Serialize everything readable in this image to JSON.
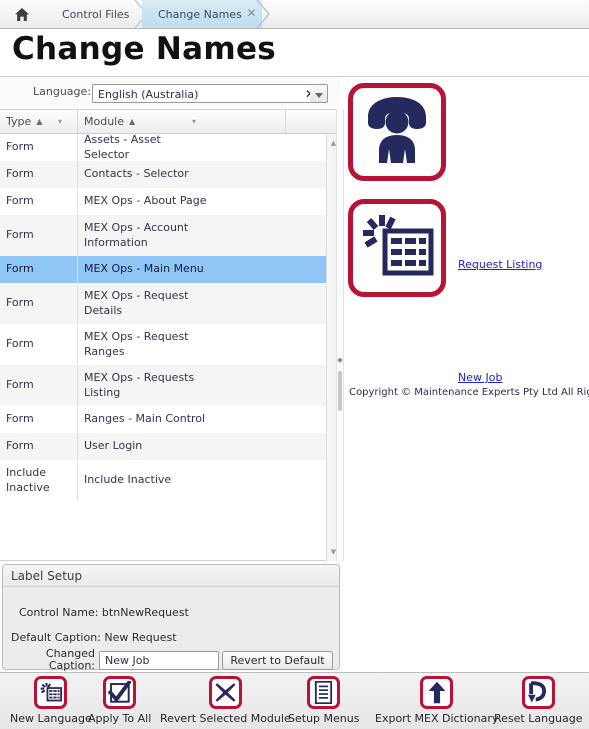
{
  "breadcrumb": {
    "home_icon": "home-icon",
    "items": [
      {
        "label": "Control Files",
        "active": false
      },
      {
        "label": "Change Names",
        "active": true
      }
    ],
    "close_glyph": "✕"
  },
  "page": {
    "title": "Change Names"
  },
  "language": {
    "label": "Language:",
    "value": "English (Australia)",
    "clear_glyph": "✕",
    "dropdown_glyph": "▼"
  },
  "grid": {
    "columns": [
      {
        "label": "Type",
        "sort": "▲",
        "menu": "▾"
      },
      {
        "label": "Module",
        "sort": "▲",
        "menu": "▾"
      },
      {
        "label": "",
        "sort": "",
        "menu": ""
      }
    ],
    "rows": [
      {
        "type": "Form",
        "module": "Assets - Asset Selector",
        "selected": false
      },
      {
        "type": "Form",
        "module": "Contacts - Selector",
        "selected": false
      },
      {
        "type": "Form",
        "module": "MEX Ops - About Page",
        "selected": false
      },
      {
        "type": "Form",
        "module": "MEX Ops - Account Information",
        "selected": false
      },
      {
        "type": "Form",
        "module": "MEX Ops - Main Menu",
        "selected": true
      },
      {
        "type": "Form",
        "module": "MEX Ops - Request Details",
        "selected": false
      },
      {
        "type": "Form",
        "module": "MEX Ops - Request Ranges",
        "selected": false
      },
      {
        "type": "Form",
        "module": "MEX Ops - Requests Listing",
        "selected": false
      },
      {
        "type": "Form",
        "module": "Ranges - Main Control",
        "selected": false
      },
      {
        "type": "Form",
        "module": "User Login",
        "selected": false
      },
      {
        "type": "Include Inactive",
        "module": "Include Inactive",
        "selected": false
      }
    ],
    "scroll_up_glyph": "▲",
    "scroll_down_glyph": "▼"
  },
  "preview": {
    "tiles": [
      {
        "icon": "phone-person-icon",
        "link": "Request Listing"
      },
      {
        "icon": "new-job-grid-icon",
        "link": "New Job"
      }
    ],
    "copyright": "Copyright © Maintenance Experts Pty Ltd All Rights Reserved"
  },
  "label_setup": {
    "title": "Label Setup",
    "control_name_label": "Control Name:",
    "control_name_value": "btnNewRequest",
    "default_caption_label": "Default Caption:",
    "default_caption_value": "New Request",
    "changed_caption_label": "Changed Caption:",
    "changed_caption_value": "New Job",
    "changed_caption_placeholder": "",
    "revert_button": "Revert to Default"
  },
  "toolbar": {
    "buttons": [
      {
        "label": "New Language",
        "icon": "new-language-icon"
      },
      {
        "label": "Apply To All",
        "icon": "check-icon"
      },
      {
        "label": "Revert Selected Module",
        "icon": "cross-icon"
      },
      {
        "label": "Setup Menus",
        "icon": "menu-list-icon"
      },
      {
        "label": "Export MEX Dictionary",
        "icon": "up-arrow-icon"
      },
      {
        "label": "Reset Language",
        "icon": "undo-icon"
      }
    ]
  },
  "colors": {
    "brand_red": "#b81237",
    "icon_navy": "#26295e",
    "selection_blue": "#8ec6f5",
    "link_blue": "#2121cc",
    "crumb_active": "#bfdcec"
  }
}
